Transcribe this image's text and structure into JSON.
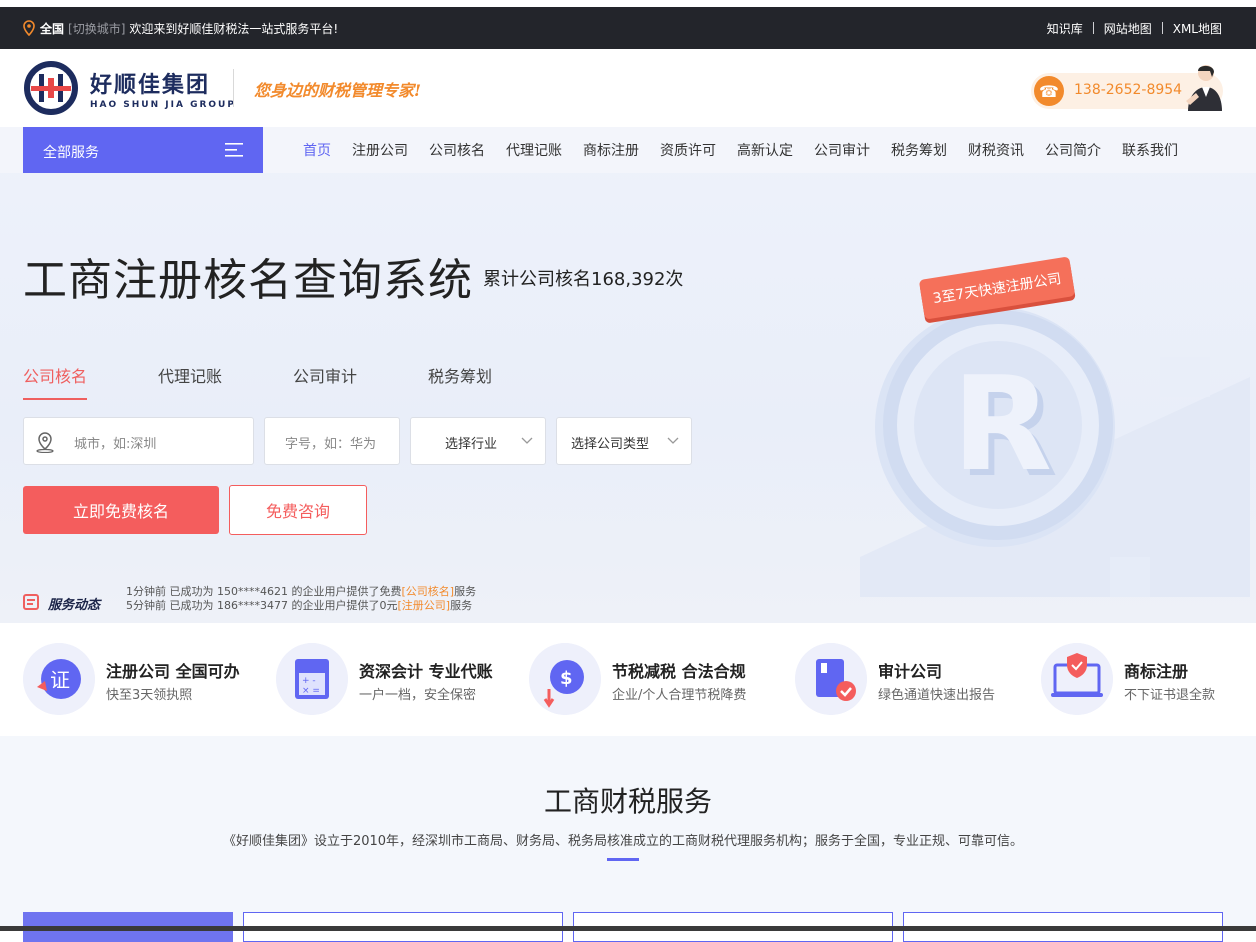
{
  "topbar": {
    "city": "全国",
    "switch_city": "[切换城市]",
    "welcome": "欢迎来到好顺佳财税法一站式服务平台!",
    "links": [
      "知识库",
      "网站地图",
      "XML地图"
    ]
  },
  "header": {
    "brand_cn": "好顺佳集团",
    "brand_en": "HAO SHUN JIA GROUP",
    "slogan": "您身边的财税管理专家!",
    "phone": "138-2652-8954"
  },
  "nav": {
    "all_services": "全部服务",
    "items": [
      "首页",
      "注册公司",
      "公司核名",
      "代理记账",
      "商标注册",
      "资质许可",
      "高新认定",
      "公司审计",
      "税务筹划",
      "财税资讯",
      "公司简介",
      "联系我们"
    ],
    "active_index": 0
  },
  "hero": {
    "title": "工商注册核名查询系统",
    "count_text": "累计公司核名168,392次",
    "badge": "3至7天快速注册公司",
    "tabs": [
      "公司核名",
      "代理记账",
      "公司审计",
      "税务筹划"
    ],
    "active_tab": 0,
    "city_placeholder": "城市，如:深圳",
    "name_placeholder": "字号，如：华为",
    "industry_select": "选择行业",
    "type_select": "选择公司类型",
    "primary_button": "立即免费核名",
    "secondary_button": "免费咨询",
    "news_label": "服务动态",
    "news_rows": [
      {
        "pre": "1分钟前 已成功为 150****4621 的企业用户提供了免费",
        "hl": "[公司核名]",
        "post": "服务"
      },
      {
        "pre": "5分钟前 已成功为 186****3477 的企业用户提供了0元",
        "hl": "[注册公司]",
        "post": "服务"
      }
    ]
  },
  "features": [
    {
      "title": "注册公司 全国可办",
      "desc": "快至3天领执照",
      "icon": "license-icon"
    },
    {
      "title": "资深会计 专业代账",
      "desc": "一户一档，安全保密",
      "icon": "calculator-icon"
    },
    {
      "title": "节税减税 合法合规",
      "desc": "企业/个人合理节税降费",
      "icon": "dollar-coin-icon"
    },
    {
      "title": "审计公司",
      "desc": "绿色通道快速出报告",
      "icon": "audit-book-icon"
    },
    {
      "title": "商标注册",
      "desc": "不下证书退全款",
      "icon": "shield-monitor-icon"
    }
  ],
  "section": {
    "title": "工商财税服务",
    "desc": "《好顺佳集团》设立于2010年，经深圳市工商局、财务局、税务局核准成立的工商财税代理服务机构；服务于全国，专业正规、可靠可信。"
  },
  "colors": {
    "accent": "#6066f2",
    "red": "#f45d5d",
    "orange": "#f28a2c",
    "dark": "#23252b"
  }
}
